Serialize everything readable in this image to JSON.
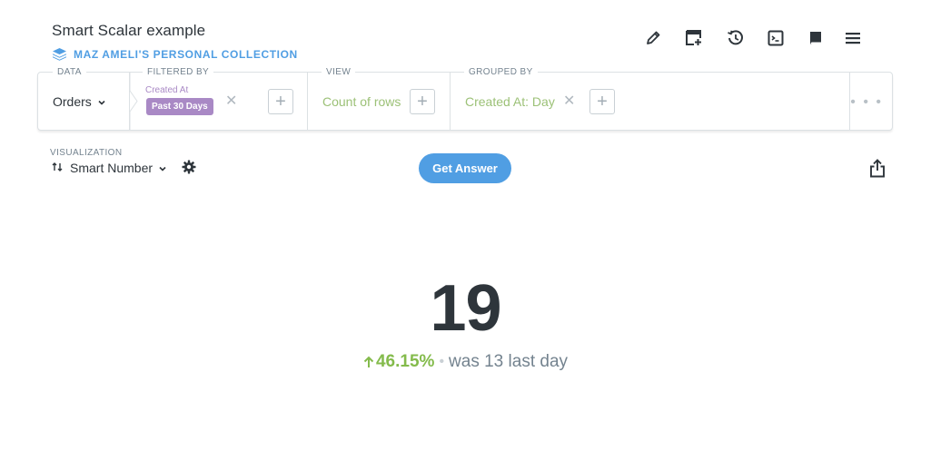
{
  "header": {
    "title": "Smart Scalar example",
    "collection_label": "MAZ AMELI'S PERSONAL COLLECTION"
  },
  "toolbar": {
    "icons": [
      "pencil-icon",
      "add-to-dashboard-icon",
      "history-icon",
      "sql-console-icon",
      "reference-book-icon",
      "menu-icon"
    ]
  },
  "query_builder": {
    "data": {
      "label": "DATA",
      "value": "Orders"
    },
    "filter": {
      "label": "FILTERED BY",
      "field": "Created At",
      "value": "Past 30 Days"
    },
    "view": {
      "label": "VIEW",
      "value": "Count of rows"
    },
    "group": {
      "label": "GROUPED BY",
      "value": "Created At: Day"
    },
    "more": "• • •"
  },
  "visualization": {
    "label": "VISUALIZATION",
    "type": "Smart Number",
    "get_answer_label": "Get Answer"
  },
  "scalar": {
    "value": "19",
    "change": "46.15%",
    "separator": "•",
    "comparison": "was 13 last day"
  },
  "colors": {
    "brand": "#509ee3",
    "filter": "#a989c5",
    "accent_green": "#84bb4c",
    "view_green": "#9cc177",
    "text_dark": "#2e353b",
    "text_medium": "#74838f"
  }
}
